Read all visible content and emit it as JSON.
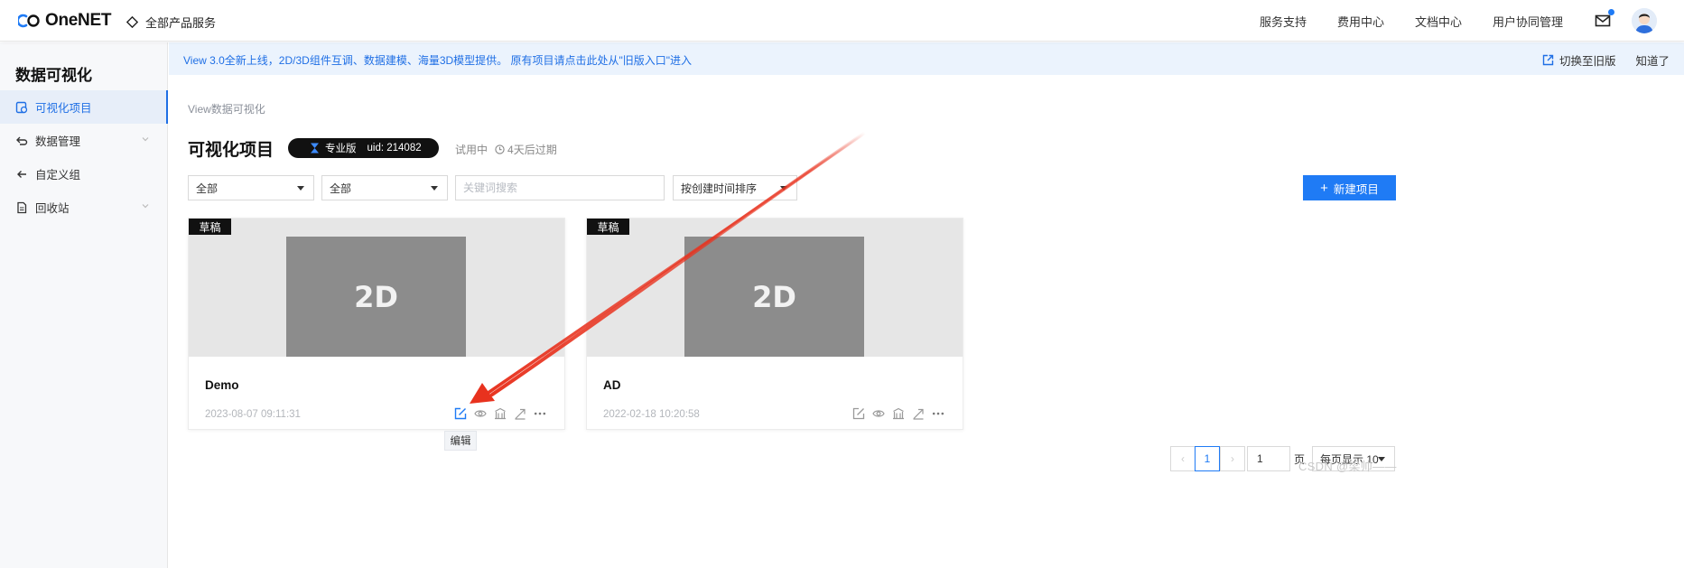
{
  "topbar": {
    "logo_text": "OneNET",
    "all_products": "全部产品服务",
    "nav": [
      "服务支持",
      "费用中心",
      "文档中心",
      "用户协同管理"
    ]
  },
  "sidebar": {
    "title": "数据可视化",
    "items": [
      {
        "label": "可视化项目",
        "active": true
      },
      {
        "label": "数据管理",
        "has_chevron": true
      },
      {
        "label": "自定义组"
      },
      {
        "label": "回收站",
        "has_chevron": true
      }
    ]
  },
  "notice": {
    "text": "View 3.0全新上线，2D/3D组件互调、数据建模、海量3D模型提供。 原有项目请点击此处从\"旧版入口\"进入",
    "switch_label": "切换至旧版",
    "dismiss_label": "知道了"
  },
  "main": {
    "breadcrumb": "View数据可视化",
    "title": "可视化项目",
    "plan_label": "专业版",
    "uid_label": "uid: 214082",
    "trial_label": "试用中",
    "expire_label": "4天后过期"
  },
  "filters": {
    "select1": "全部",
    "select2": "全部",
    "search_placeholder": "关键词搜索",
    "sort": "按创建时间排序",
    "new_button": "新建项目"
  },
  "cards": [
    {
      "badge": "草稿",
      "thumb_label": "2D",
      "name": "Demo",
      "created": "2023-08-07 09:11:31"
    },
    {
      "badge": "草稿",
      "thumb_label": "2D",
      "name": "AD",
      "created": "2022-02-18 10:20:58"
    }
  ],
  "tooltip": "编辑",
  "pagination": {
    "prev": "‹",
    "current": "1",
    "next": "›",
    "jump_value": "1",
    "unit": "页",
    "page_size": "每页显示 10"
  },
  "watermark": "CSDN @梁帅——",
  "colors": {
    "accent": "#1f7bf5",
    "annotation_arrow": "#e8321e"
  }
}
